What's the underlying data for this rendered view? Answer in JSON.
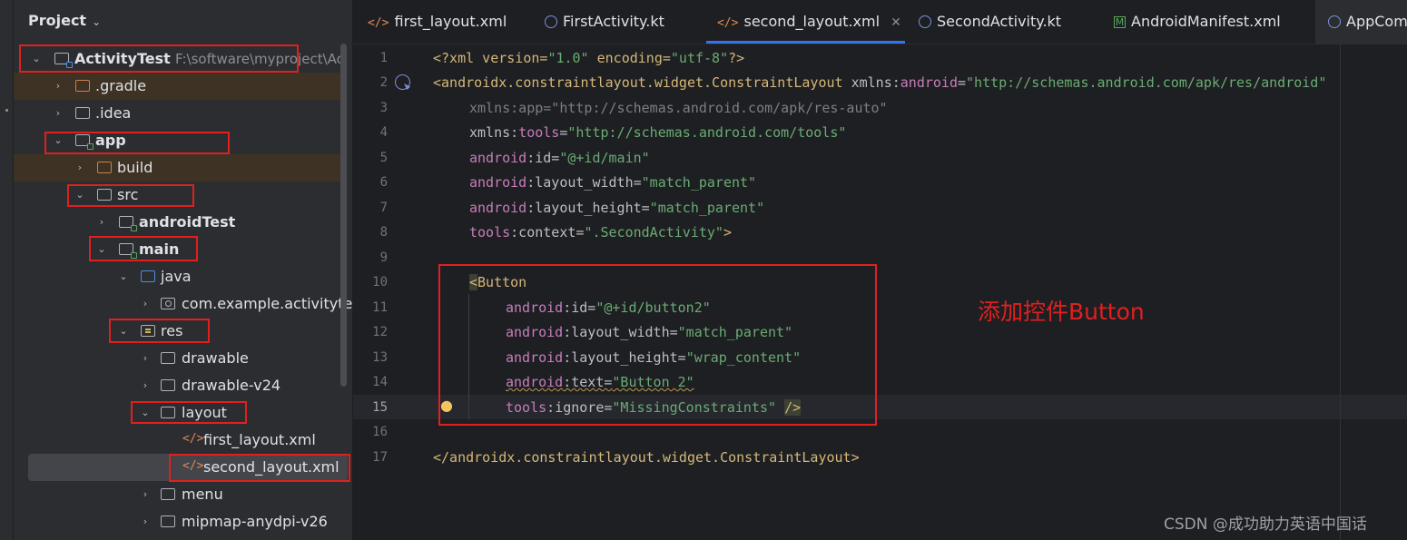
{
  "project_panel": {
    "title": "Project",
    "tree": [
      {
        "label": "ActivityTest",
        "path": "F:\\software\\myproject\\Ac",
        "expanded": true
      },
      {
        "label": ".gradle",
        "expanded": false
      },
      {
        "label": ".idea",
        "expanded": false
      },
      {
        "label": "app",
        "expanded": true
      },
      {
        "label": "build",
        "expanded": false
      },
      {
        "label": "src",
        "expanded": true
      },
      {
        "label": "androidTest",
        "expanded": false
      },
      {
        "label": "main",
        "expanded": true
      },
      {
        "label": "java",
        "expanded": true
      },
      {
        "label": "com.example.activitytest",
        "expanded": false
      },
      {
        "label": "res",
        "expanded": true
      },
      {
        "label": "drawable",
        "expanded": false
      },
      {
        "label": "drawable-v24",
        "expanded": false
      },
      {
        "label": "layout",
        "expanded": true
      },
      {
        "label": "first_layout.xml"
      },
      {
        "label": "second_layout.xml",
        "selected": true
      },
      {
        "label": "menu",
        "expanded": false
      },
      {
        "label": "mipmap-anydpi-v26",
        "expanded": false
      }
    ]
  },
  "tabs": [
    {
      "label": "first_layout.xml",
      "icon": "xml-file-icon"
    },
    {
      "label": "FirstActivity.kt",
      "icon": "kotlin-class-icon"
    },
    {
      "label": "second_layout.xml",
      "icon": "xml-file-icon",
      "active": true
    },
    {
      "label": "SecondActivity.kt",
      "icon": "kotlin-class-icon"
    },
    {
      "label": "AndroidManifest.xml",
      "icon": "manifest-icon"
    },
    {
      "label": "AppCom",
      "icon": "class-icon"
    }
  ],
  "editor": {
    "current_line": 15,
    "line_numbers": [
      "1",
      "2",
      "3",
      "4",
      "5",
      "6",
      "7",
      "8",
      "9",
      "10",
      "11",
      "12",
      "13",
      "14",
      "15",
      "16",
      "17"
    ],
    "lines": {
      "l1": {
        "a": "<?xml version=",
        "b": "\"1.0\"",
        "c": " encoding=",
        "d": "\"utf-8\"",
        "e": "?>"
      },
      "l2": {
        "a": "<androidx.constraintlayout.widget.ConstraintLayout",
        "b": " xmlns:",
        "c": "android",
        "d": "=",
        "e": "\"http://schemas.android.com/apk/res/android\""
      },
      "l3": {
        "a": "xmlns:app=\"http://schemas.android.com/apk/res-auto\""
      },
      "l4": {
        "a": "xmlns:",
        "b": "tools",
        "c": "=",
        "d": "\"http://schemas.android.com/tools\""
      },
      "l5": {
        "a": "android",
        "b": ":id=",
        "c": "\"@+id/main\""
      },
      "l6": {
        "a": "android",
        "b": ":layout_width=",
        "c": "\"match_parent\""
      },
      "l7": {
        "a": "android",
        "b": ":layout_height=",
        "c": "\"match_parent\""
      },
      "l8": {
        "a": "tools",
        "b": ":context=",
        "c": "\".SecondActivity\"",
        "d": ">"
      },
      "l10": {
        "a": "<",
        "b": "Button"
      },
      "l11": {
        "a": "android",
        "b": ":id=",
        "c": "\"@+id/button2\""
      },
      "l12": {
        "a": "android",
        "b": ":layout_width=",
        "c": "\"match_parent\""
      },
      "l13": {
        "a": "android",
        "b": ":layout_height=",
        "c": "\"wrap_content\""
      },
      "l14": {
        "a": "android",
        "b": ":text=",
        "c": "\"Button 2\""
      },
      "l15": {
        "a": "tools",
        "b": ":ignore=",
        "c": "\"MissingConstraints\"",
        "d": " ",
        "e": "/>"
      },
      "l17": {
        "a": "</androidx.constraintlayout.widget.ConstraintLayout>"
      }
    }
  },
  "annotation": "添加控件Button",
  "watermark": "CSDN @成功助力英语中国话",
  "colors": {
    "highlight_box": "#e0201f",
    "active_tab_underline": "#3574f0",
    "editor_bg": "#1e1f22",
    "panel_bg": "#2b2d30"
  }
}
